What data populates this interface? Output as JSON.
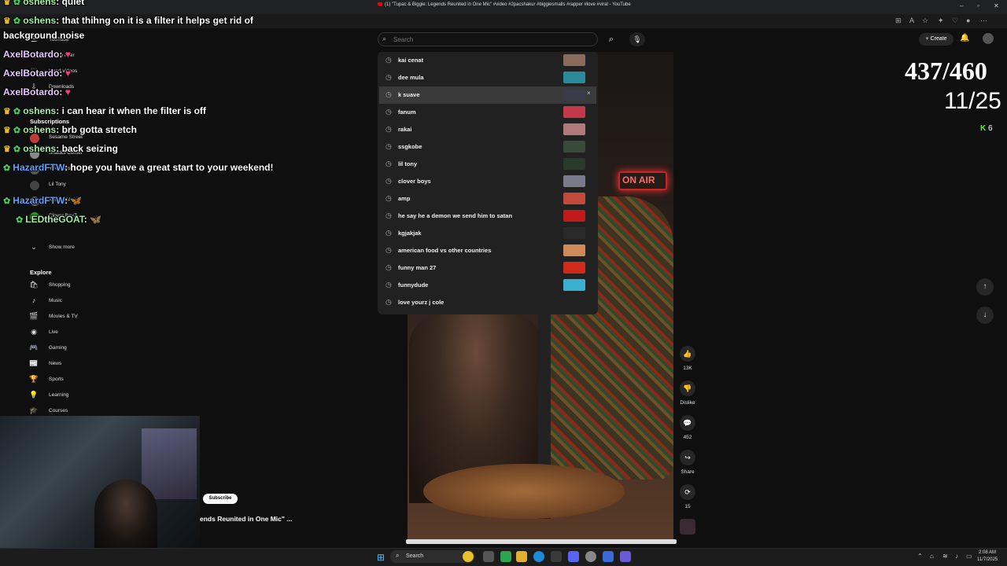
{
  "browser": {
    "tab_title": "(1) \"Tupac & Biggie: Legends Reunited in One Mic\" #video #2pacshakur #biggiesmalls #rapper #love #viral - YouTube"
  },
  "youtube": {
    "search_placeholder": "Search",
    "create_label": "Create",
    "suggestions": [
      {
        "label": "kai cenat",
        "thumb": "#8a6a5a"
      },
      {
        "label": "dee mula",
        "thumb": "#2a8a9a"
      },
      {
        "label": "k suave",
        "thumb": "#3a3a4a"
      },
      {
        "label": "fanum",
        "thumb": "#c23a4a"
      },
      {
        "label": "rakai",
        "thumb": "#b07a7a"
      },
      {
        "label": "ssgkobe",
        "thumb": "#3a4a3a"
      },
      {
        "label": "lil tony",
        "thumb": "#2a3a2a"
      },
      {
        "label": "clover boys",
        "thumb": "#7a7a8a"
      },
      {
        "label": "amp",
        "thumb": "#c24a3a"
      },
      {
        "label": "he say he a demon we send him to satan",
        "thumb": "#c21a1a"
      },
      {
        "label": "kgjakjak",
        "thumb": "#2a2a2a"
      },
      {
        "label": "american food vs other countries",
        "thumb": "#d08a5a"
      },
      {
        "label": "funny man 27",
        "thumb": "#d02a1a"
      },
      {
        "label": "funnydude",
        "thumb": "#3ab0d0"
      },
      {
        "label": "love yourz j cole",
        "thumb": "#212121"
      }
    ],
    "remove_glyph": "×",
    "neon_sign": "ON AIR",
    "actions": [
      {
        "name": "like",
        "icon": "👍",
        "label": "13K"
      },
      {
        "name": "dislike",
        "icon": "👎",
        "label": "Dislike"
      },
      {
        "name": "comments",
        "icon": "💬",
        "label": "452"
      },
      {
        "name": "share",
        "icon": "↪",
        "label": "Share"
      },
      {
        "name": "remix",
        "icon": "⟳",
        "label": "15"
      }
    ],
    "nav_up": "↑",
    "nav_down": "↓",
    "sidebar": {
      "top_items": [
        {
          "icon": "☰",
          "label": "YouTube"
        },
        {
          "icon": "◷",
          "label": "Watch later"
        },
        {
          "icon": "♡",
          "label": "Liked videos"
        },
        {
          "icon": "⇩",
          "label": "Downloads"
        }
      ],
      "subscriptions_heading": "Subscriptions",
      "subscriptions": [
        {
          "label": "Sesame Street",
          "color": "#c23a3a"
        },
        {
          "label": "Snacks Corner",
          "color": "#888888"
        },
        {
          "label": "YFG Fatso",
          "color": "#555555"
        },
        {
          "label": "Lil Tony",
          "color": "#444444"
        },
        {
          "label": "KGJAKJAK",
          "color": "#666666"
        },
        {
          "label": "Clover BoyZ",
          "color": "#2a9a2a"
        }
      ],
      "show_more": "Show more",
      "explore_heading": "Explore",
      "explore": [
        {
          "icon": "🛍",
          "label": "Shopping"
        },
        {
          "icon": "♪",
          "label": "Music"
        },
        {
          "icon": "🎬",
          "label": "Movies & TV"
        },
        {
          "icon": "◉",
          "label": "Live"
        },
        {
          "icon": "🎮",
          "label": "Gaming"
        },
        {
          "icon": "📰",
          "label": "News"
        },
        {
          "icon": "🏆",
          "label": "Sports"
        },
        {
          "icon": "💡",
          "label": "Learning"
        },
        {
          "icon": "🎓",
          "label": "Courses"
        }
      ]
    },
    "subscribe_label": "Subscribe",
    "video_title_snippet": "ends Reunited in One Mic\" ..."
  },
  "chat": [
    {
      "badges": "crown-check",
      "name": "oshens",
      "name_color": "g",
      "message": "quiet"
    },
    {
      "badges": "crown-check",
      "name": "oshens",
      "name_color": "g",
      "message": "that thihng on it is a filter it helps get rid of"
    },
    {
      "badges": "none",
      "name": "",
      "name_color": "g",
      "message": "background noise"
    },
    {
      "badges": "none",
      "name": "AxelBotardo",
      "name_color": "p",
      "message": "♥"
    },
    {
      "badges": "none",
      "name": "AxelBotardo",
      "name_color": "p",
      "message": "♥"
    },
    {
      "badges": "none",
      "name": "AxelBotardo",
      "name_color": "p",
      "message": "♥"
    },
    {
      "badges": "crown-check",
      "name": "oshens",
      "name_color": "g",
      "message": "i can hear it when the filter is off"
    },
    {
      "badges": "crown-check",
      "name": "oshens",
      "name_color": "g",
      "message": "brb gotta stretch"
    },
    {
      "badges": "crown-check",
      "name": "oshens",
      "name_color": "g",
      "message": "back seizing"
    },
    {
      "badges": "check",
      "name": "HazardFTW",
      "name_color": "b",
      "message": "hope you have a great start to your weekend!"
    },
    {
      "badges": "check",
      "name": "HazardFTW",
      "name_color": "b",
      "message": "🦋"
    },
    {
      "badges": "check",
      "name": "LEDtheGOAT",
      "name_color": "g",
      "message": "🦋"
    }
  ],
  "overlay": {
    "counter_main": "437/460",
    "counter_sub": "11/25",
    "kick_badge": "K",
    "kick_count": "6"
  },
  "taskbar": {
    "search_label": "Search",
    "time": "2:08 AM",
    "date": "11/7/2025"
  },
  "colors": {
    "accent_blue": "#4cc2ff",
    "kick_green": "#53fc18",
    "chat_green": "#38d25a",
    "crown_gold": "#e8b92a"
  }
}
